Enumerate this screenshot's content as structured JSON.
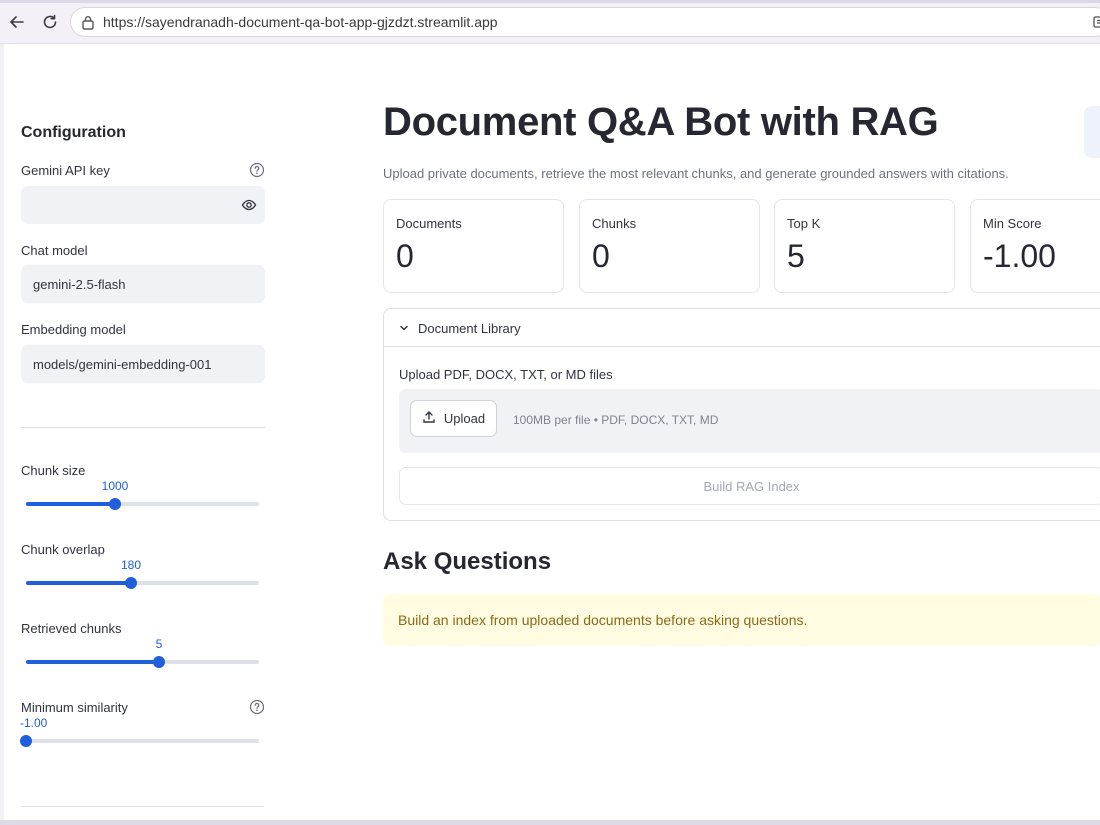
{
  "browser": {
    "url": "https://sayendranadh-document-qa-bot-app-gjzdzt.streamlit.app"
  },
  "sidebar": {
    "title": "Configuration",
    "api_key": {
      "label": "Gemini API key",
      "value": ""
    },
    "chat_model": {
      "label": "Chat model",
      "value": "gemini-2.5-flash"
    },
    "embedding_model": {
      "label": "Embedding model",
      "value": "models/gemini-embedding-001"
    },
    "sliders": [
      {
        "label": "Chunk size",
        "value": "1000",
        "fraction": 0.38
      },
      {
        "label": "Chunk overlap",
        "value": "180",
        "fraction": 0.45
      },
      {
        "label": "Retrieved chunks",
        "value": "5",
        "fraction": 0.57
      },
      {
        "label": "Minimum similarity",
        "value": "-1.00",
        "fraction": 0.0
      }
    ]
  },
  "main": {
    "title": "Document Q&A Bot with RAG",
    "subtitle": "Upload private documents, retrieve the most relevant chunks, and generate grounded answers with citations.",
    "metrics": [
      {
        "label": "Documents",
        "value": "0"
      },
      {
        "label": "Chunks",
        "value": "0"
      },
      {
        "label": "Top K",
        "value": "5"
      },
      {
        "label": "Min Score",
        "value": "-1.00"
      }
    ],
    "library": {
      "title": "Document Library",
      "upload_label": "Upload PDF, DOCX, TXT, or MD files",
      "upload_button": "Upload",
      "upload_hint": "100MB per file • PDF, DOCX, TXT, MD",
      "build_button": "Build RAG Index"
    },
    "ask": {
      "title": "Ask Questions",
      "warning": "Build an index from uploaded documents before asking questions."
    }
  },
  "colors": {
    "accent": "#1f5fd9",
    "warning_bg": "#fffce2",
    "warning_text": "#8a6a17"
  }
}
